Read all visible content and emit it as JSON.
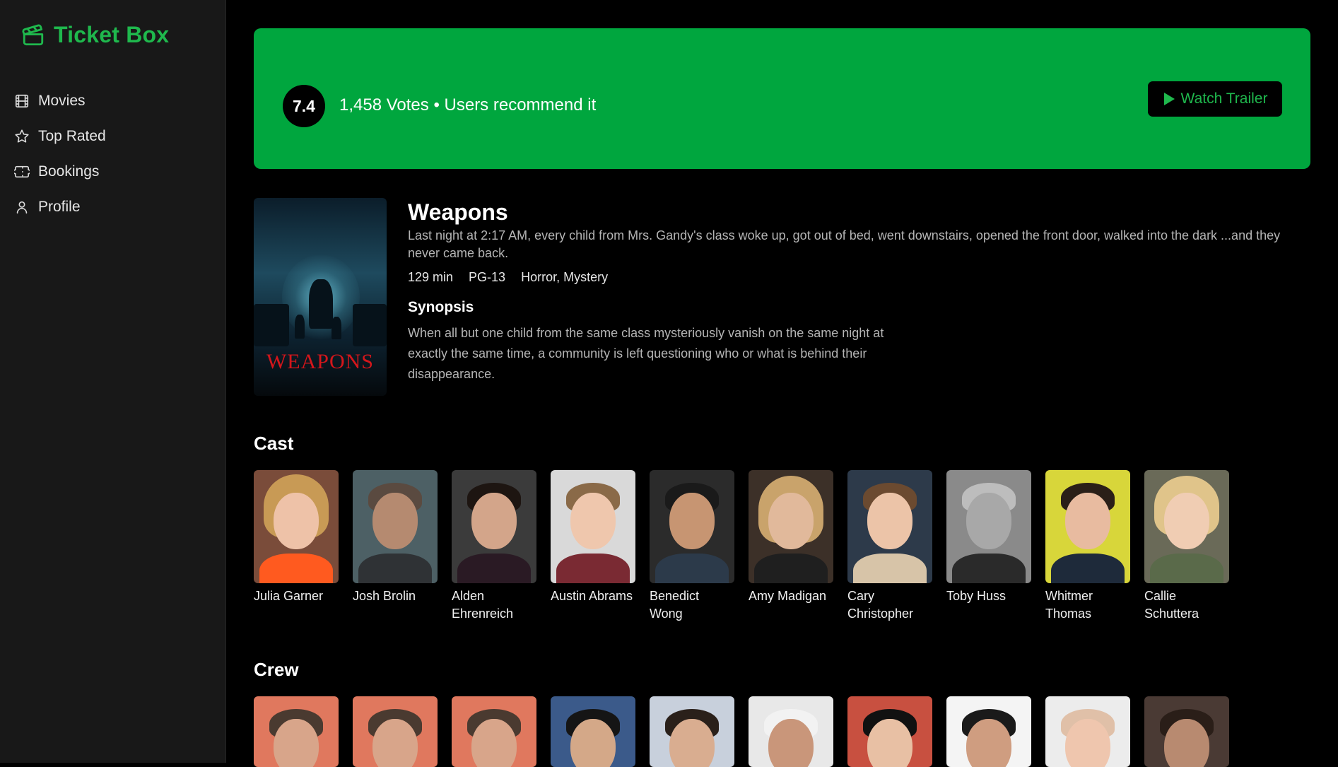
{
  "app": {
    "name": "Ticket Box"
  },
  "colors": {
    "accent": "#1fb84d",
    "banner": "#00a63e",
    "sidebar": "#181818",
    "background": "#000000"
  },
  "sidebar": {
    "items": [
      {
        "label": "Movies",
        "icon": "film-icon"
      },
      {
        "label": "Top Rated",
        "icon": "star-icon"
      },
      {
        "label": "Bookings",
        "icon": "ticket-icon"
      },
      {
        "label": "Profile",
        "icon": "user-icon"
      }
    ]
  },
  "banner": {
    "rating": "7.4",
    "votes_text": "1,458 Votes • Users recommend it",
    "trailer_label": "Watch Trailer"
  },
  "movie": {
    "title": "Weapons",
    "poster_text": "WEAPONS",
    "tagline": "Last night at 2:17 AM, every child from Mrs. Gandy's class woke up, got out of bed, went downstairs, opened the front door, walked into the dark ...and they never came back.",
    "runtime": "129 min",
    "rating": "PG-13",
    "genres": "Horror, Mystery",
    "synopsis_heading": "Synopsis",
    "synopsis": "When all but one child from the same class mysteriously vanish on the same night at exactly the same time, a community is left questioning who or what is behind their disappearance."
  },
  "cast": {
    "heading": "Cast",
    "people": [
      {
        "name": "Julia Garner"
      },
      {
        "name": "Josh Brolin"
      },
      {
        "name": "Alden Ehrenreich"
      },
      {
        "name": "Austin Abrams"
      },
      {
        "name": "Benedict Wong"
      },
      {
        "name": "Amy Madigan"
      },
      {
        "name": "Cary Christopher"
      },
      {
        "name": "Toby Huss"
      },
      {
        "name": "Whitmer Thomas"
      },
      {
        "name": "Callie Schuttera"
      }
    ]
  },
  "crew": {
    "heading": "Crew"
  }
}
